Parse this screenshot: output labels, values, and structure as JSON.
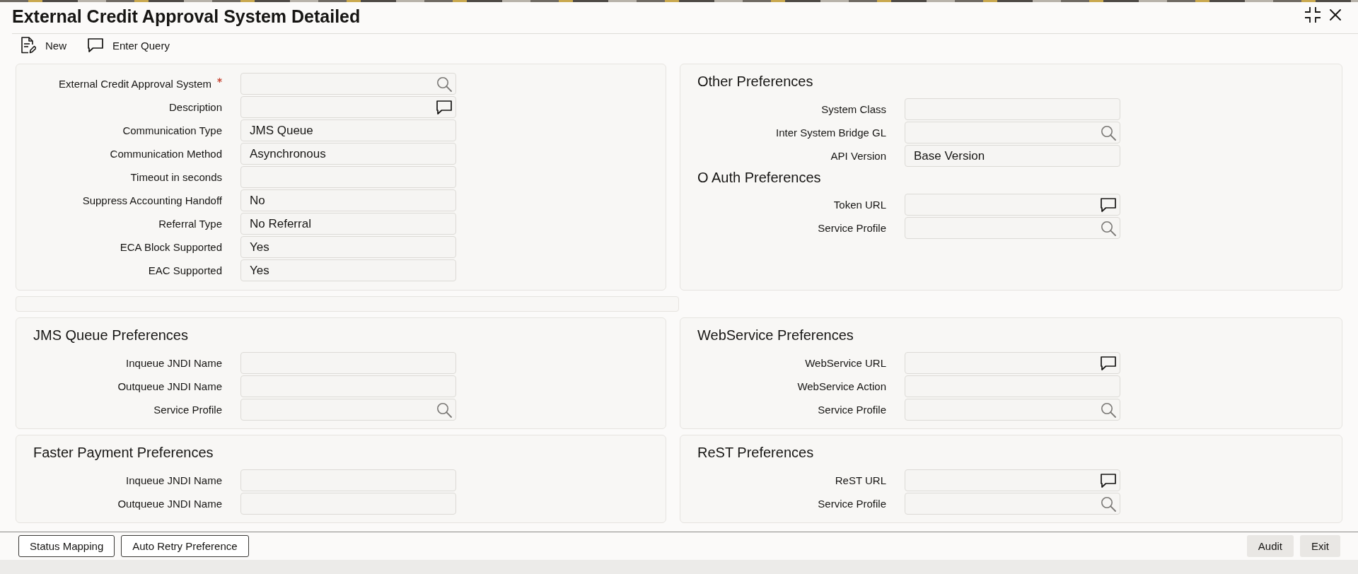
{
  "window": {
    "title": "External Credit Approval System Detailed"
  },
  "toolbar": [
    {
      "label": "New",
      "kind": "new"
    },
    {
      "label": "Enter Query",
      "kind": "query"
    }
  ],
  "main_panel": {
    "fields": [
      {
        "label": "External Credit Approval System",
        "required": true,
        "kind": "lookup"
      },
      {
        "label": "Description",
        "required": false,
        "kind": "memo"
      },
      {
        "label": "Communication Type",
        "required": false,
        "kind": "plain",
        "value": "JMS Queue"
      },
      {
        "label": "Communication Method",
        "required": false,
        "kind": "plain",
        "value": "Asynchronous"
      },
      {
        "label": "Timeout in seconds",
        "required": false,
        "kind": "plain"
      },
      {
        "label": "Suppress Accounting Handoff",
        "required": false,
        "kind": "plain",
        "value": "No"
      },
      {
        "label": "Referral Type",
        "required": false,
        "kind": "plain",
        "value": "No Referral"
      },
      {
        "label": "ECA Block Supported",
        "required": false,
        "kind": "plain",
        "value": "Yes"
      },
      {
        "label": "EAC Supported",
        "required": false,
        "kind": "plain",
        "value": "Yes"
      }
    ]
  },
  "other_panel": {
    "groups": [
      {
        "title": "Other Preferences",
        "fields": [
          {
            "label": "System Class",
            "kind": "plain"
          },
          {
            "label": "Inter System Bridge GL",
            "kind": "lookup"
          },
          {
            "label": "API Version",
            "kind": "plain",
            "value": "Base Version"
          }
        ]
      },
      {
        "title": "O Auth Preferences",
        "fields": [
          {
            "label": "Token URL",
            "kind": "memo"
          },
          {
            "label": "Service Profile",
            "kind": "lookup"
          }
        ]
      }
    ]
  },
  "jms_queue_preferences": {
    "title": "JMS Queue Preferences",
    "fields": [
      {
        "label": "Inqueue JNDI Name",
        "kind": "plain"
      },
      {
        "label": "Outqueue JNDI Name",
        "kind": "plain"
      },
      {
        "label": "Service Profile",
        "kind": "lookup"
      }
    ]
  },
  "webservice_preferences": {
    "title": "WebService Preferences",
    "fields": [
      {
        "label": "WebService URL",
        "kind": "memo"
      },
      {
        "label": "WebService Action",
        "kind": "plain"
      },
      {
        "label": "Service Profile",
        "kind": "lookup"
      }
    ]
  },
  "faster_payment_preferences": {
    "title": "Faster Payment Preferences",
    "fields": [
      {
        "label": "Inqueue JNDI Name"
      },
      {
        "label": "Outqueue JNDI Name"
      }
    ]
  },
  "rest_preferences": {
    "title": "ReST Preferences",
    "fields": [
      {
        "label": "ReST URL",
        "kind": "memo"
      },
      {
        "label": "Service Profile",
        "kind": "lookup"
      }
    ]
  },
  "footer": {
    "left_buttons": [
      "Status Mapping",
      "Auto Retry Preference"
    ],
    "right_buttons": [
      "Audit",
      "Exit"
    ]
  }
}
